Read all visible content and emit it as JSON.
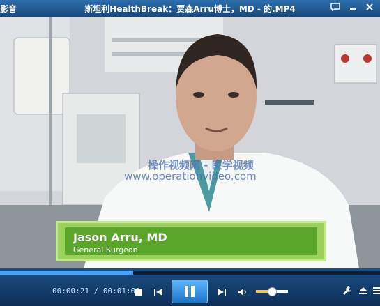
{
  "app": {
    "title_left": "影音",
    "window_title": "斯坦利HealthBreak：贾森Arru博士，MD - 的.MP4"
  },
  "overlay": {
    "name": "Jason Arru, MD",
    "title": "General Surgeon"
  },
  "watermark": {
    "chinese": "操作视频网 - 医学视频",
    "url": "www.operationvideo.com"
  },
  "playback": {
    "elapsed": "00:00:21",
    "total": "00:01:00",
    "separator": "/",
    "progress_fraction": 0.35,
    "volume_fraction": 0.5
  },
  "icons": {
    "chat": "chat-icon",
    "min": "minimize-icon",
    "close": "close-icon",
    "stop": "stop-icon",
    "prev": "previous-icon",
    "pause": "pause-icon",
    "next": "next-icon",
    "volume": "volume-icon",
    "tools": "wrench-icon",
    "eject": "eject-icon",
    "list": "playlist-icon"
  },
  "colors": {
    "accent": "#3fa3ff",
    "lower_third": "#5aa62b",
    "volume": "#f5c35a"
  }
}
